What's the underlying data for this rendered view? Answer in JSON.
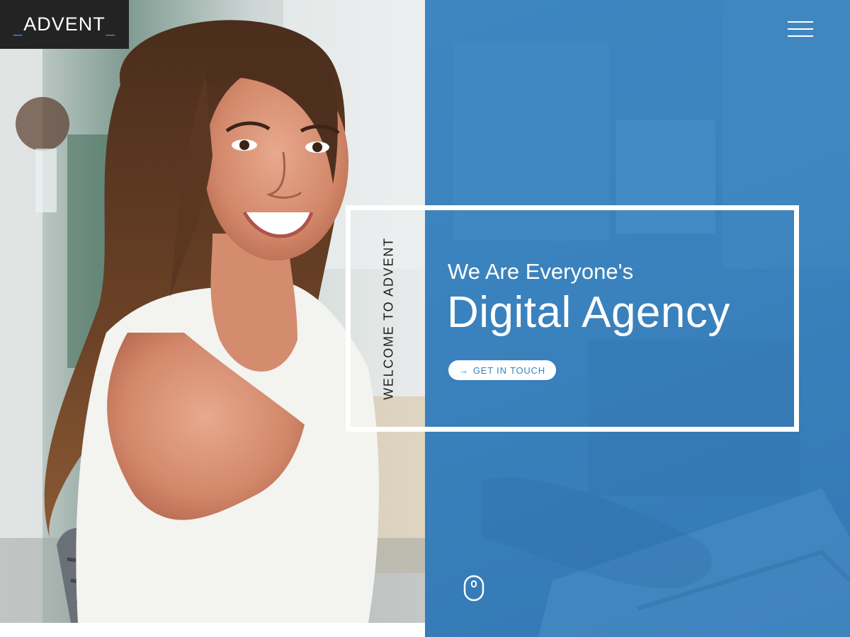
{
  "logo": {
    "prefix": "_",
    "word": "ADVENT",
    "suffix": "_"
  },
  "hero": {
    "welcome": "WELCOME TO ADVENT",
    "tagline": "We Are Everyone's",
    "headline": "Digital Agency",
    "cta_arrow": "→",
    "cta_label": "GET IN TOUCH"
  },
  "icons": {
    "menu": "hamburger-icon",
    "scroll": "mouse-scroll-icon",
    "cta": "arrow-right-icon"
  },
  "colors": {
    "accent_blue": "#3a82bd",
    "logo_bg": "#232323",
    "logo_underscore": "#3d8fd0",
    "text_white": "#ffffff"
  }
}
